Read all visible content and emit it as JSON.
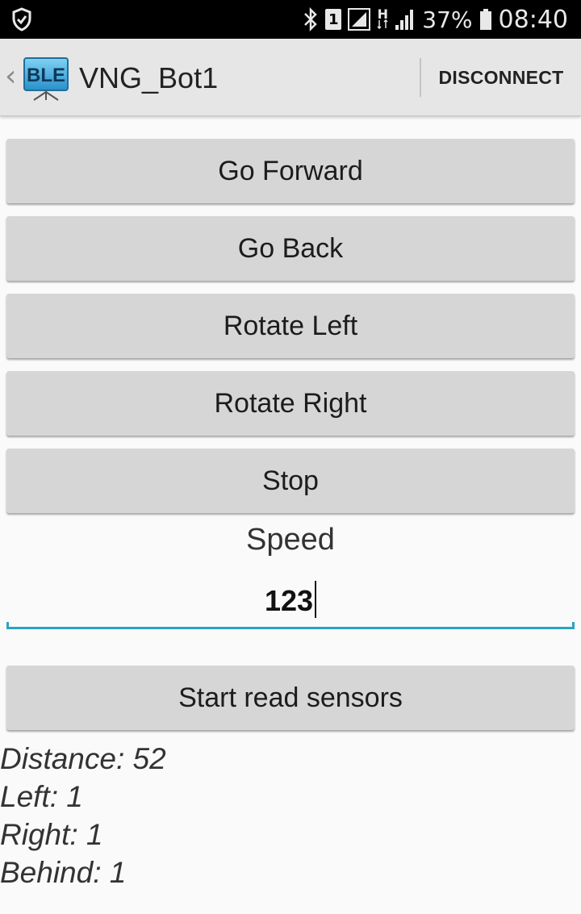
{
  "status_bar": {
    "battery_percent": "37%",
    "time": "08:40",
    "sim_badge": "1",
    "network_type": "H"
  },
  "action_bar": {
    "app_icon_text": "BLE",
    "title": "VNG_Bot1",
    "disconnect_label": "DISCONNECT"
  },
  "controls": {
    "go_forward": "Go Forward",
    "go_back": "Go Back",
    "rotate_left": "Rotate Left",
    "rotate_right": "Rotate Right",
    "stop": "Stop"
  },
  "speed": {
    "label": "Speed",
    "value": "123"
  },
  "sensors": {
    "start_button": "Start read sensors",
    "distance": "Distance: 52",
    "left": "Left: 1",
    "right": "Right: 1",
    "behind": "Behind: 1"
  },
  "colors": {
    "status_bar_bg": "#000000",
    "action_bar_bg": "#e6e6e6",
    "button_bg": "#d6d6d6",
    "input_underline": "#2aa3c4"
  }
}
